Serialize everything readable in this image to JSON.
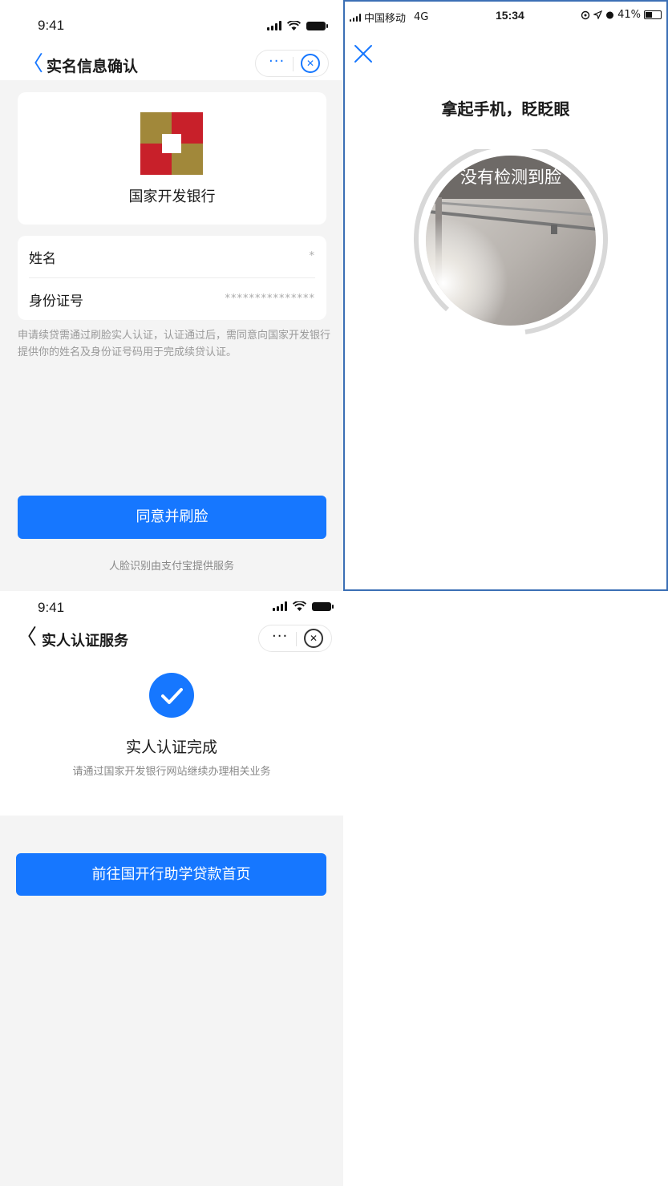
{
  "panel_a": {
    "status_time": "9:41",
    "nav_title": "实名信息确认",
    "capsule_more": "···",
    "capsule_close": "✕",
    "bank_name": "国家开发银行",
    "fields": [
      {
        "label": "姓名",
        "value": "*"
      },
      {
        "label": "身份证号",
        "value": "***************"
      }
    ],
    "notice": "申请续贷需通过刷脸实人认证，认证通过后，需同意向国家开发银行提供你的姓名及身份证号码用于完成续贷认证。",
    "agree_button": "同意并刷脸",
    "footer": "人脸识别由支付宝提供服务",
    "accent_color": "#1677ff"
  },
  "panel_b": {
    "carrier": "中国移动",
    "network": "4G",
    "time": "15:34",
    "battery": "41%",
    "title": "拿起手机，眨眨眼",
    "hint": "没有检测到脸"
  },
  "panel_c": {
    "status_time": "9:41",
    "nav_title": "实人认证服务",
    "capsule_more": "···",
    "capsule_close": "✕",
    "success_title": "实人认证完成",
    "success_subtitle": "请通过国家开发银行网站继续办理相关业务",
    "go_button": "前往国开行助学贷款首页"
  }
}
